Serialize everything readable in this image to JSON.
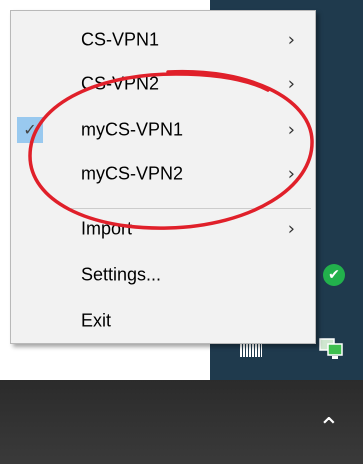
{
  "menu": {
    "items": [
      {
        "label": "CS-VPN1",
        "submenu": true,
        "checked": false
      },
      {
        "label": "CS-VPN2",
        "submenu": true,
        "checked": false
      },
      {
        "label": "myCS-VPN1",
        "submenu": true,
        "checked": true
      },
      {
        "label": "myCS-VPN2",
        "submenu": true,
        "checked": false
      },
      {
        "label": "Import",
        "submenu": true,
        "checked": false
      },
      {
        "label": "Settings...",
        "submenu": false,
        "checked": false
      },
      {
        "label": "Exit",
        "submenu": false,
        "checked": false
      }
    ],
    "arrow_glyph": "›",
    "check_glyph": "✓"
  },
  "tray": {
    "check_glyph": "✔",
    "chevron_glyph": "⌃"
  },
  "colors": {
    "annotation_red": "#e0202a",
    "check_highlight": "#99c9ef",
    "tray_dark": "#1f3a4d"
  },
  "icons": [
    "chevron-right-icon",
    "checkmark-icon",
    "green-check-icon",
    "computer-network-icon",
    "battery-icon",
    "chevron-up-icon"
  ]
}
